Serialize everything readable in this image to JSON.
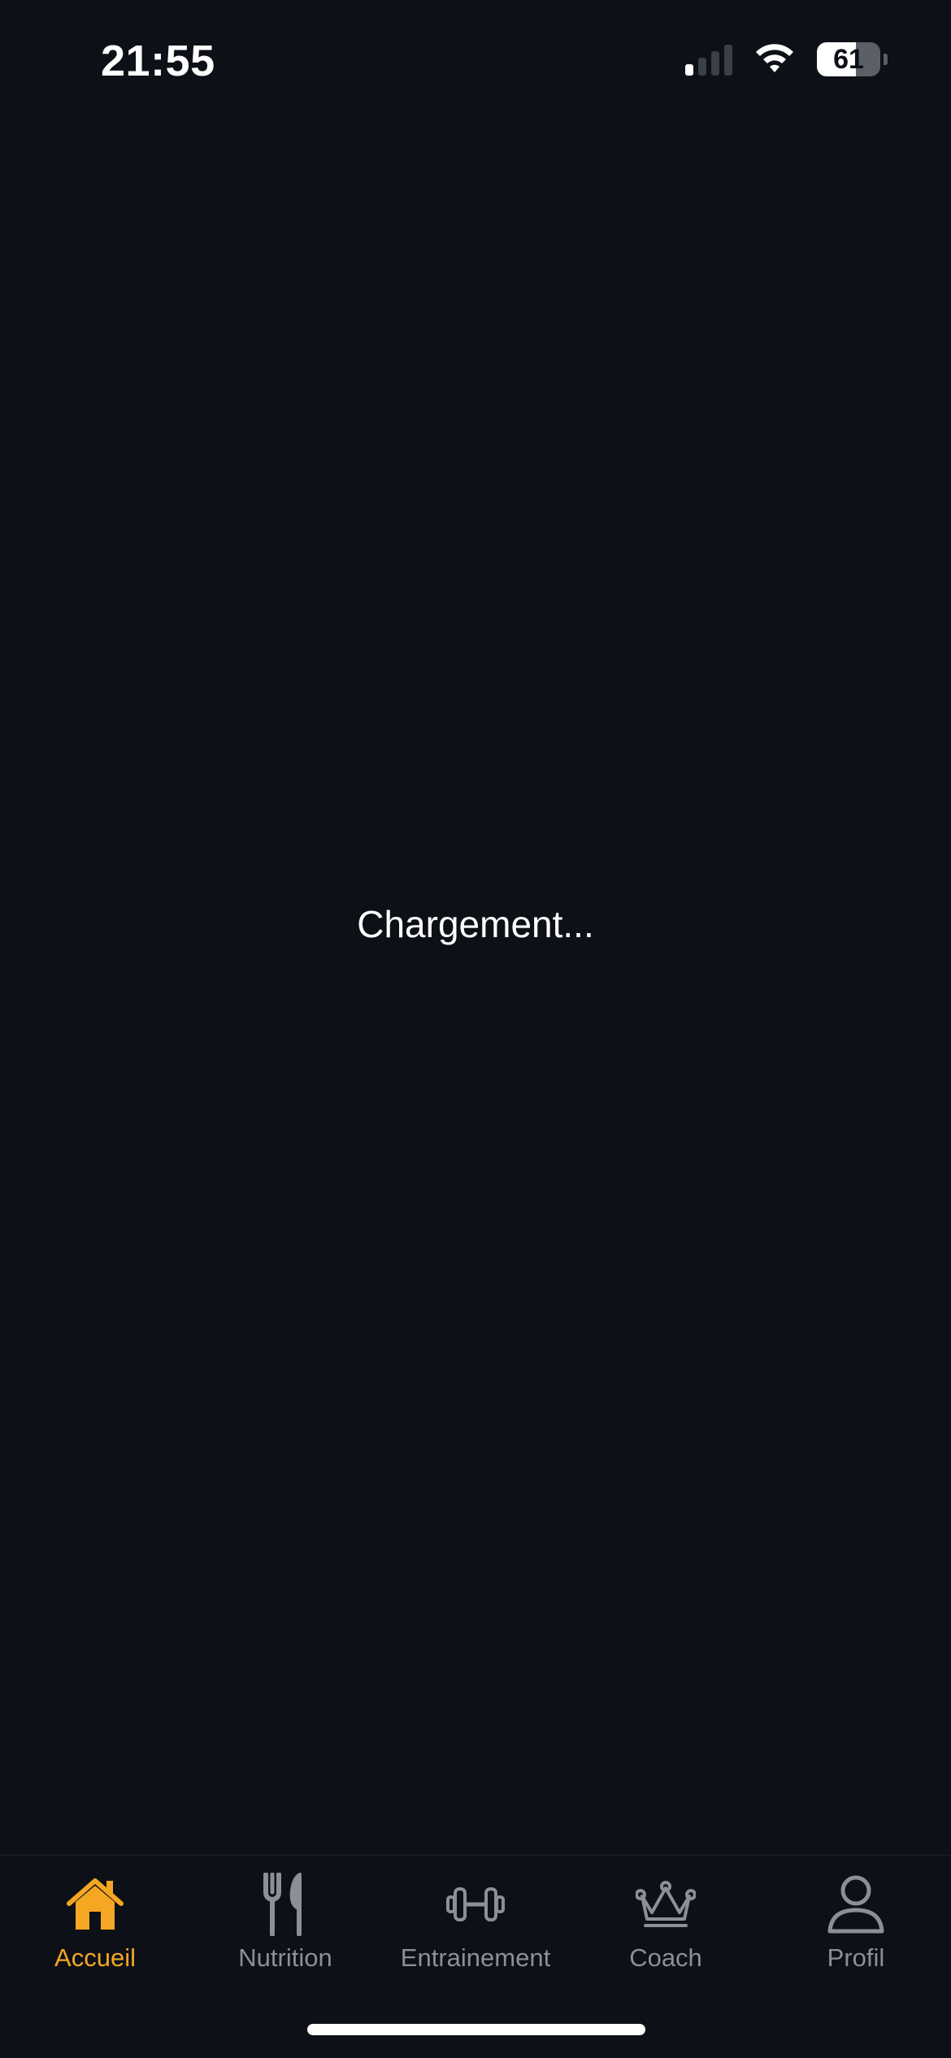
{
  "status_bar": {
    "time": "21:55",
    "battery_level": "61",
    "signal_bars_active": 1,
    "signal_bars_total": 4
  },
  "main": {
    "loading_text": "Chargement..."
  },
  "tab_bar": {
    "active_color": "#f5a623",
    "inactive_color": "#8a8f98",
    "items": [
      {
        "label": "Accueil",
        "icon": "home-icon",
        "active": true
      },
      {
        "label": "Nutrition",
        "icon": "fork-knife-icon",
        "active": false
      },
      {
        "label": "Entrainement",
        "icon": "dumbbell-icon",
        "active": false
      },
      {
        "label": "Coach",
        "icon": "crown-icon",
        "active": false
      },
      {
        "label": "Profil",
        "icon": "user-icon",
        "active": false
      }
    ]
  },
  "colors": {
    "background": "#0d1017",
    "text": "#ffffff"
  }
}
